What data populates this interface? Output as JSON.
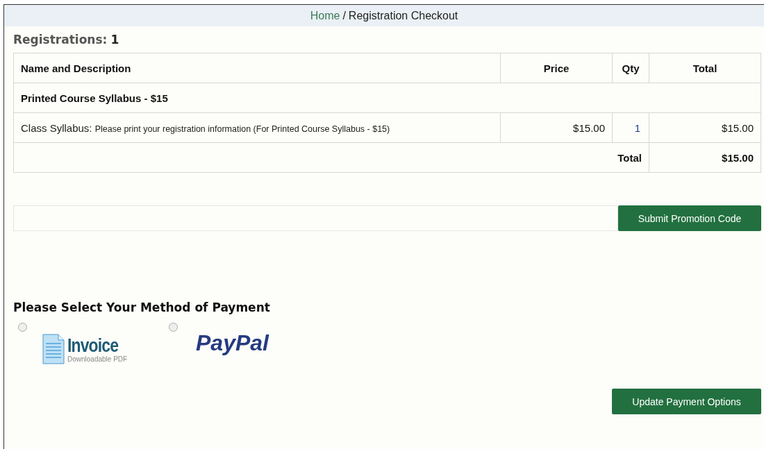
{
  "breadcrumb": {
    "home": "Home",
    "separator": "/",
    "current": "Registration Checkout"
  },
  "registrations": {
    "label": "Registrations:",
    "count": "1"
  },
  "table": {
    "columns": [
      "Name and Description",
      "Price",
      "Qty",
      "Total"
    ],
    "group": "Printed Course Syllabus - $15",
    "rows": [
      {
        "name": "Class Syllabus:",
        "description": "Please print your registration information (For Printed Course Syllabus - $15)",
        "price": "$15.00",
        "qty": "1",
        "total": "$15.00"
      }
    ],
    "footer": {
      "label": "Total",
      "value": "$15.00"
    }
  },
  "promo": {
    "button": "Submit Promotion Code"
  },
  "payment": {
    "heading": "Please Select Your Method of Payment",
    "options": [
      {
        "kind": "invoice",
        "selected": false,
        "title": "Invoice",
        "subtitle": "Downloadable PDF"
      },
      {
        "kind": "paypal",
        "selected": false,
        "title": "PayPal"
      }
    ]
  },
  "update_button": "Update Payment Options"
}
